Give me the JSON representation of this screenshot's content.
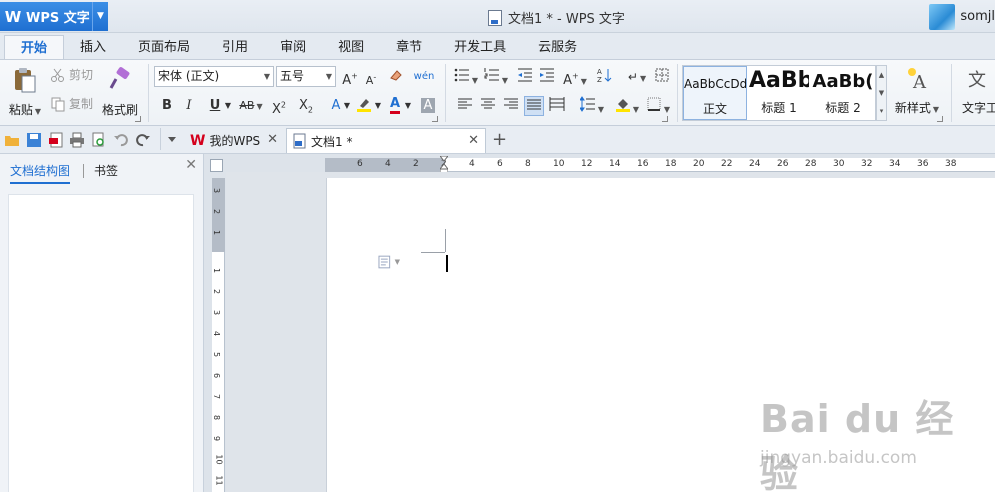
{
  "app": {
    "name": "WPS 文字",
    "window_title": "文档1 * - WPS 文字",
    "user": "somjl"
  },
  "ribbon_tabs": [
    "开始",
    "插入",
    "页面布局",
    "引用",
    "审阅",
    "视图",
    "章节",
    "开发工具",
    "云服务"
  ],
  "active_tab": "开始",
  "clipboard": {
    "paste": "粘贴",
    "cut": "剪切",
    "copy": "复制",
    "format_painter": "格式刷"
  },
  "font": {
    "family": "宋体 (正文)",
    "size": "五号"
  },
  "styles": [
    {
      "sample": "AaBbCcDd",
      "label": "正文"
    },
    {
      "sample": "AaBb",
      "label": "标题 1"
    },
    {
      "sample": "AaBb(",
      "label": "标题 2"
    }
  ],
  "new_style": "新样式",
  "text_tools": "文字工",
  "doc_tabs": [
    {
      "label": "我的WPS",
      "active": false
    },
    {
      "label": "文档1 *",
      "active": true
    }
  ],
  "nav_panel": {
    "tabs": [
      "文档结构图",
      "书签"
    ],
    "active": "文档结构图"
  },
  "ruler": {
    "h_margin_numbers": [
      "6",
      "4",
      "2"
    ],
    "h_body_numbers": [
      "2",
      "4",
      "6",
      "8",
      "10",
      "12",
      "14",
      "16",
      "18",
      "20",
      "22",
      "24",
      "26",
      "28",
      "30",
      "32",
      "34",
      "36",
      "38"
    ],
    "v_margin_numbers": [
      "3",
      "2",
      "1"
    ],
    "v_body_numbers": [
      "1",
      "2",
      "3",
      "4",
      "5",
      "6",
      "7",
      "8",
      "9",
      "10",
      "11"
    ]
  },
  "watermark": {
    "main": "Bai du 经验",
    "sub": "jingyan.baidu.com"
  },
  "colors": {
    "accent": "#1f6fd1",
    "font_red": "#d4001c",
    "highlight_yellow": "#ffe400"
  }
}
